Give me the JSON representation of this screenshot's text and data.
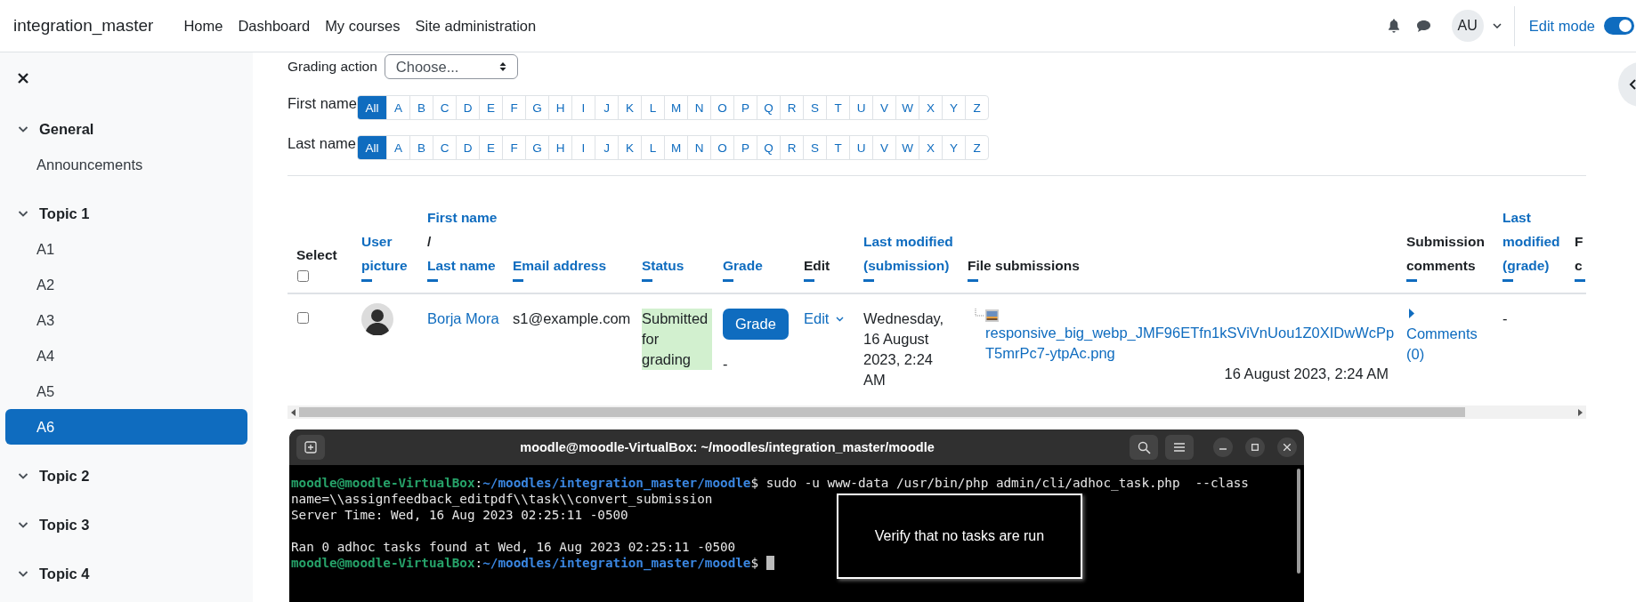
{
  "navbar": {
    "brand": "integration_master",
    "links": [
      "Home",
      "Dashboard",
      "My courses",
      "Site administration"
    ],
    "avatar": "AU",
    "edit_mode": {
      "label": "Edit mode",
      "on": true
    }
  },
  "sidebar": {
    "sections": [
      {
        "title": "General",
        "expanded": true,
        "items": [
          {
            "label": "Announcements",
            "selected": false
          }
        ]
      },
      {
        "title": "Topic 1",
        "expanded": true,
        "items": [
          {
            "label": "A1",
            "selected": false
          },
          {
            "label": "A2",
            "selected": false
          },
          {
            "label": "A3",
            "selected": false
          },
          {
            "label": "A4",
            "selected": false
          },
          {
            "label": "A5",
            "selected": false
          },
          {
            "label": "A6",
            "selected": true
          }
        ]
      },
      {
        "title": "Topic 2",
        "expanded": true
      },
      {
        "title": "Topic 3",
        "expanded": true
      },
      {
        "title": "Topic 4",
        "expanded": true
      }
    ]
  },
  "grading_action": {
    "label": "Grading action",
    "value": "Choose..."
  },
  "initial_filters": [
    {
      "label": "First name",
      "letters": [
        {
          "label": "All",
          "selected": true
        },
        {
          "label": "A",
          "selected": false
        },
        {
          "label": "B",
          "selected": false
        },
        {
          "label": "C",
          "selected": false
        },
        {
          "label": "D",
          "selected": false
        },
        {
          "label": "E",
          "selected": false
        },
        {
          "label": "F",
          "selected": false
        },
        {
          "label": "G",
          "selected": false
        },
        {
          "label": "H",
          "selected": false
        },
        {
          "label": "I",
          "selected": false
        },
        {
          "label": "J",
          "selected": false
        },
        {
          "label": "K",
          "selected": false
        },
        {
          "label": "L",
          "selected": false
        },
        {
          "label": "M",
          "selected": false
        },
        {
          "label": "N",
          "selected": false
        },
        {
          "label": "O",
          "selected": false
        },
        {
          "label": "P",
          "selected": false
        },
        {
          "label": "Q",
          "selected": false
        },
        {
          "label": "R",
          "selected": false
        },
        {
          "label": "S",
          "selected": false
        },
        {
          "label": "T",
          "selected": false
        },
        {
          "label": "U",
          "selected": false
        },
        {
          "label": "V",
          "selected": false
        },
        {
          "label": "W",
          "selected": false
        },
        {
          "label": "X",
          "selected": false
        },
        {
          "label": "Y",
          "selected": false
        },
        {
          "label": "Z",
          "selected": false
        }
      ]
    },
    {
      "label": "Last name",
      "letters": [
        {
          "label": "All",
          "selected": true
        },
        {
          "label": "A",
          "selected": false
        },
        {
          "label": "B",
          "selected": false
        },
        {
          "label": "C",
          "selected": false
        },
        {
          "label": "D",
          "selected": false
        },
        {
          "label": "E",
          "selected": false
        },
        {
          "label": "F",
          "selected": false
        },
        {
          "label": "G",
          "selected": false
        },
        {
          "label": "H",
          "selected": false
        },
        {
          "label": "I",
          "selected": false
        },
        {
          "label": "J",
          "selected": false
        },
        {
          "label": "K",
          "selected": false
        },
        {
          "label": "L",
          "selected": false
        },
        {
          "label": "M",
          "selected": false
        },
        {
          "label": "N",
          "selected": false
        },
        {
          "label": "O",
          "selected": false
        },
        {
          "label": "P",
          "selected": false
        },
        {
          "label": "Q",
          "selected": false
        },
        {
          "label": "R",
          "selected": false
        },
        {
          "label": "S",
          "selected": false
        },
        {
          "label": "T",
          "selected": false
        },
        {
          "label": "U",
          "selected": false
        },
        {
          "label": "V",
          "selected": false
        },
        {
          "label": "W",
          "selected": false
        },
        {
          "label": "X",
          "selected": false
        },
        {
          "label": "Y",
          "selected": false
        },
        {
          "label": "Z",
          "selected": false
        }
      ]
    }
  ],
  "table": {
    "columns": [
      {
        "kind": "select",
        "parts": [
          {
            "text": "Select",
            "link": false
          }
        ],
        "checked": false
      },
      {
        "kind": "text",
        "parts": [
          {
            "text": "User picture",
            "link": true
          }
        ]
      },
      {
        "kind": "text",
        "parts": [
          {
            "text": "First name",
            "link": true
          },
          {
            "text": "/",
            "link": false
          },
          {
            "text": "Last name",
            "link": true
          }
        ]
      },
      {
        "kind": "text",
        "parts": [
          {
            "text": "Email address",
            "link": true
          }
        ]
      },
      {
        "kind": "text",
        "parts": [
          {
            "text": "Status",
            "link": true
          }
        ]
      },
      {
        "kind": "text",
        "parts": [
          {
            "text": "Grade",
            "link": true
          }
        ]
      },
      {
        "kind": "text",
        "parts": [
          {
            "text": "Edit",
            "link": false
          }
        ]
      },
      {
        "kind": "text",
        "parts": [
          {
            "text": "Last modified (submission)",
            "link": true
          }
        ]
      },
      {
        "kind": "text",
        "parts": [
          {
            "text": "File submissions",
            "link": false
          }
        ]
      },
      {
        "kind": "text",
        "parts": [
          {
            "text": "Submission comments",
            "link": false
          }
        ]
      },
      {
        "kind": "text",
        "parts": [
          {
            "text": "Last modified (grade)",
            "link": true
          }
        ]
      },
      {
        "kind": "text",
        "parts": [
          {
            "text": "F c",
            "link": false
          }
        ]
      }
    ],
    "rows": [
      {
        "cells": [
          {
            "kind": "checkbox",
            "checked": false
          },
          {
            "kind": "avatar"
          },
          {
            "kind": "link",
            "text": "Borja Mora"
          },
          {
            "kind": "text",
            "text": "s1@example.com"
          },
          {
            "kind": "status",
            "text": "Submitted for grading"
          },
          {
            "kind": "grade",
            "button": "Grade",
            "value": "-"
          },
          {
            "kind": "menu",
            "text": "Edit"
          },
          {
            "kind": "text",
            "text": "Wednesday, 16 August 2023, 2:24 AM"
          },
          {
            "kind": "file",
            "file": "responsive_big_webp_JMF96ETfn1kSViVnUou1Z0XIDwWcPpT5mrPc7-ytpAc.png",
            "date": "16 August 2023, 2:24 AM"
          },
          {
            "kind": "comments",
            "text": "Comments (0)",
            "expanded": false
          },
          {
            "kind": "text",
            "text": "-"
          }
        ]
      }
    ]
  },
  "terminal": {
    "title": "moodle@moodle-VirtualBox: ~/moodles/integration_master/moodle",
    "lines": [
      {
        "blank_before": false,
        "cursor": false,
        "segments": [
          {
            "kind": "user",
            "text": "moodle@moodle-VirtualBox"
          },
          {
            "kind": "plain",
            "text": ":"
          },
          {
            "kind": "path",
            "text": "~/moodles/integration_master/moodle"
          },
          {
            "kind": "plain",
            "text": "$ sudo -u www-data /usr/bin/php admin/cli/adhoc_task.php  --class"
          }
        ]
      },
      {
        "blank_before": false,
        "cursor": false,
        "segments": [
          {
            "kind": "plain",
            "text": "name=\\\\assignfeedback_editpdf\\\\task\\\\convert_submission"
          }
        ]
      },
      {
        "blank_before": false,
        "cursor": false,
        "segments": [
          {
            "kind": "plain",
            "text": "Server Time: Wed, 16 Aug 2023 02:25:11 -0500"
          }
        ]
      },
      {
        "blank_before": true,
        "cursor": false,
        "segments": [
          {
            "kind": "plain",
            "text": "Ran 0 adhoc tasks found at Wed, 16 Aug 2023 02:25:11 -0500"
          }
        ]
      },
      {
        "blank_before": false,
        "cursor": true,
        "segments": [
          {
            "kind": "user",
            "text": "moodle@moodle-VirtualBox"
          },
          {
            "kind": "plain",
            "text": ":"
          },
          {
            "kind": "path",
            "text": "~/moodles/integration_master/moodle"
          },
          {
            "kind": "plain",
            "text": "$ "
          }
        ]
      }
    ]
  },
  "annotation": {
    "text": "Verify that no tasks are run"
  }
}
